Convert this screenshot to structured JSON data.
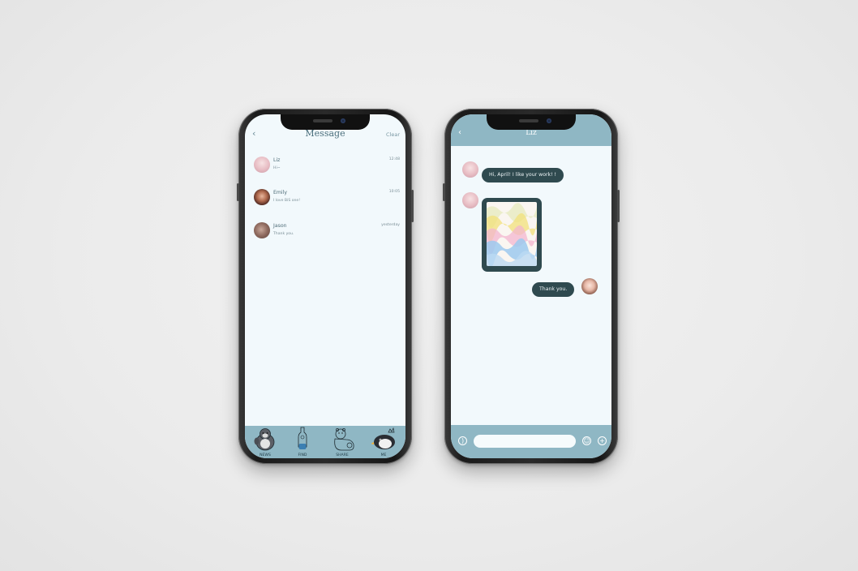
{
  "message_screen": {
    "back_icon": "chevron-left-icon",
    "title": "Message",
    "clear_label": "Clear",
    "conversations": [
      {
        "name": "Liz",
        "preview": "Hi~",
        "time": "12:48",
        "avatar_color": "#e9c6cd"
      },
      {
        "name": "Emily",
        "preview": "I love BiS one!",
        "time": "10:05",
        "avatar_color": "#7a3b32"
      },
      {
        "name": "Jason",
        "preview": "Thank you.",
        "time": "yesterday",
        "avatar_color": "#8e6a5e"
      }
    ],
    "tabs": [
      {
        "label": "NEWS",
        "icon": "penguin-icon"
      },
      {
        "label": "FIND",
        "icon": "bottle-figure-icon"
      },
      {
        "label": "SHARE",
        "icon": "bear-icon"
      },
      {
        "label": "ME",
        "icon": "penguin-crown-icon"
      }
    ]
  },
  "chat_screen": {
    "title": "Liz",
    "back_icon": "chevron-left-icon",
    "messages": [
      {
        "from": "Liz",
        "text": "Hi, April! I like your work! !"
      },
      {
        "from": "Liz",
        "type": "image",
        "image": "marbled-artwork"
      },
      {
        "from": "me",
        "text": "Thank you."
      }
    ],
    "input_placeholder": "",
    "voice_icon": "voice-icon",
    "emoji_icon": "emoji-icon",
    "add_icon": "plus-icon"
  },
  "colors": {
    "accent": "#8fb7c4",
    "bubble": "#2f4a4f",
    "screen_bg": "#f2f9fc"
  }
}
